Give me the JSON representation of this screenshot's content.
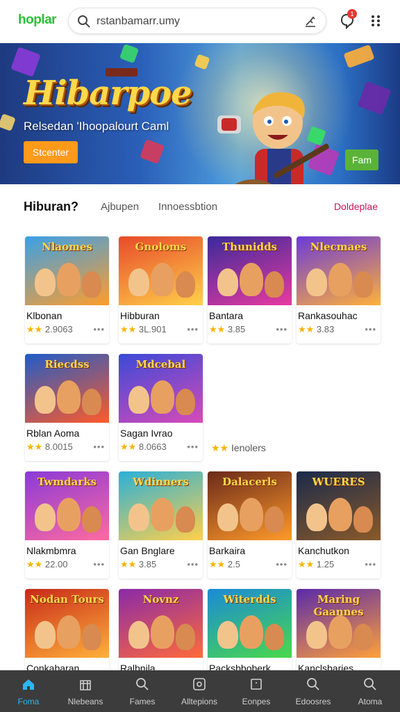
{
  "app": {
    "logo": "hoplar"
  },
  "search": {
    "value": "rstanbamarr.umy"
  },
  "notifications": {
    "badge": "1"
  },
  "hero": {
    "title": "Hibarpoe",
    "subtitle": "Relsedan 'Ihoopalourt Caml",
    "primary_button": "Stcenter",
    "secondary_button": "Fam",
    "accent": "#ff9a1a"
  },
  "tabs": {
    "items": [
      "Hiburan?",
      "Ajbupen",
      "Innoessbtion"
    ],
    "right_link": "Doldeplae"
  },
  "grid": {
    "cards": [
      {
        "title": "Klbonan",
        "rating": "2.9063",
        "thumb_text": "Nlaomes",
        "colors": [
          "#3aa0e8",
          "#ff9d2a"
        ]
      },
      {
        "title": "Hibburan",
        "rating": "3L.901",
        "thumb_text": "Gnoloms",
        "colors": [
          "#e84a2a",
          "#ffd04a"
        ]
      },
      {
        "title": "Bantara",
        "rating": "3.85",
        "thumb_text": "Thunidds",
        "colors": [
          "#3a2a9a",
          "#e83aa0"
        ]
      },
      {
        "title": "Rankasouhac",
        "rating": "3.83",
        "thumb_text": "Nlecmaes",
        "colors": [
          "#6a3ad8",
          "#ffb03a"
        ]
      },
      {
        "title": "Rblan Aoma",
        "rating": "8.0015",
        "thumb_text": "Riecdss",
        "colors": [
          "#1f5cc8",
          "#ff5a2a"
        ]
      },
      {
        "title": "Sagan Ivrao",
        "rating": "8.0663",
        "thumb_text": "Mdcebal",
        "colors": [
          "#3a4ad8",
          "#d84ab8"
        ]
      },
      {
        "title": "Nlakmbmra",
        "rating": "22.00",
        "thumb_text": "Twmdarks",
        "colors": [
          "#8a3ad8",
          "#ff6aa0"
        ]
      },
      {
        "title": "Gan Bnglare",
        "rating": "3.85",
        "thumb_text": "Wdinners",
        "colors": [
          "#2ab0d8",
          "#ffd04a"
        ]
      },
      {
        "title": "Barkaira",
        "rating": "2.5",
        "thumb_text": "Dalacerls",
        "colors": [
          "#6a2a1a",
          "#ff9a2a"
        ]
      },
      {
        "title": "Kanchutkon",
        "rating": "1.25",
        "thumb_text": "WUERES",
        "colors": [
          "#1a2a4a",
          "#8a5a2a"
        ]
      },
      {
        "title": "Conkabaran",
        "rating": "",
        "thumb_text": "Nodan Tours",
        "colors": [
          "#c82a1a",
          "#ffb03a"
        ]
      },
      {
        "title": "Ralbnila",
        "rating": "",
        "thumb_text": "Novnz",
        "colors": [
          "#8a2aa8",
          "#ff6a3a"
        ]
      },
      {
        "title": "Packsbboberk",
        "rating": "",
        "thumb_text": "Witerdds",
        "colors": [
          "#1a8ad8",
          "#4ad84a"
        ]
      },
      {
        "title": "Kanclsbaries",
        "rating": "",
        "thumb_text": "Maring Gaannes",
        "colors": [
          "#5a2aa8",
          "#ffa03a"
        ]
      }
    ],
    "loose_rating": "Ienolers"
  },
  "bottom_nav": {
    "items": [
      {
        "label": "Foma",
        "icon": "home-icon",
        "active": true
      },
      {
        "label": "Nlebeans",
        "icon": "store-icon",
        "active": false
      },
      {
        "label": "Fames",
        "icon": "search-icon",
        "active": false
      },
      {
        "label": "Alltepions",
        "icon": "apps-icon",
        "active": false
      },
      {
        "label": "Eonpes",
        "icon": "square-icon",
        "active": false
      },
      {
        "label": "Edoosres",
        "icon": "search-icon",
        "active": false
      },
      {
        "label": "Atoma",
        "icon": "search-icon",
        "active": false
      }
    ],
    "active_color": "#29b6f6"
  }
}
